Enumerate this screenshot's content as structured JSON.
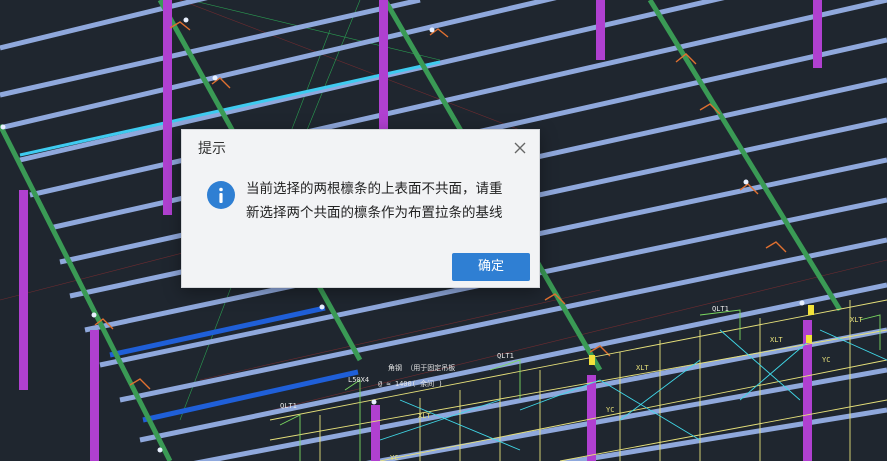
{
  "dialog": {
    "title": "提示",
    "message_line1": "当前选择的两根檩条的上表面不共面，请重",
    "message_line2": "新选择两个共面的檩条作为布置拉条的基线",
    "ok_label": "确定"
  },
  "viewport": {
    "labels": {
      "qlt1_a": "QLT1",
      "qlt1_b": "QLT1",
      "qlt1_c": "QLT1",
      "l50x4": "L50X4",
      "angle_note": "角钢 （用于固定吊板",
      "spacing_note": "@ ≈ 1400(  余间  )",
      "yc1": "YC",
      "yc2": "YC",
      "yc3": "YC",
      "xlt1": "XLT",
      "xlt2": "XLT",
      "xlt3": "XLT",
      "xlt4": "XLT"
    }
  },
  "colors": {
    "background": "#1f262f",
    "purlin": "#8fa8dc",
    "rafter": "#3a9a55",
    "column": "#b040d0",
    "selected_purlin": "#1f5fd8",
    "highlight_purlin": "#3ecbf0",
    "dialog_button": "#2f7fd3"
  }
}
